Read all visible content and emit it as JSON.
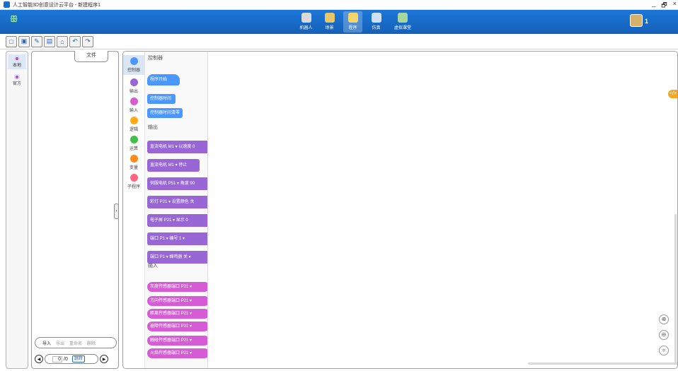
{
  "window": {
    "title": "人工智能3D创意设计云平台 - 新建程序1",
    "controls": [
      "_",
      "🗗",
      "×"
    ]
  },
  "topnav": {
    "logo": "ꕥ",
    "items": [
      {
        "label": "机器人",
        "icon": "robot-icon",
        "color": "#d9d9d9"
      },
      {
        "label": "场景",
        "icon": "scene-icon",
        "color": "#e8c76a"
      },
      {
        "label": "程序",
        "icon": "program-icon",
        "color": "#f5d66a",
        "active": true
      },
      {
        "label": "仿真",
        "icon": "simulation-icon",
        "color": "#cfe0f5"
      },
      {
        "label": "虚拟课堂",
        "icon": "virtual-classroom-icon",
        "color": "#a7d7a0"
      }
    ],
    "user_count": "1"
  },
  "toolbar": {
    "buttons": [
      "new-icon",
      "save-icon",
      "open-icon",
      "chart-icon",
      "home-icon",
      "undo-icon",
      "redo-icon"
    ]
  },
  "leftcol": {
    "items": [
      {
        "label": "本地",
        "active": true
      },
      {
        "label": "官方",
        "active": false
      }
    ]
  },
  "filepanel": {
    "tab": "文件",
    "actions": [
      "导入",
      "导出",
      "重命名",
      "删除"
    ],
    "pager": {
      "prev": "◀",
      "page_input": "0",
      "total": "/0",
      "go": "跳转",
      "next": "▶"
    }
  },
  "categories": [
    {
      "label": "控制器",
      "color": "#4c97ff",
      "active": true
    },
    {
      "label": "输出",
      "color": "#9966d6"
    },
    {
      "label": "输入",
      "color": "#d65cd6"
    },
    {
      "label": "逻辑",
      "color": "#ffab19"
    },
    {
      "label": "运算",
      "color": "#40bf4a"
    },
    {
      "label": "变量",
      "color": "#ff8c1a"
    },
    {
      "label": "子程序",
      "color": "#ff6680"
    }
  ],
  "palette": {
    "sections": [
      {
        "title": "控制器",
        "blocks": [
          "程序开始",
          "控制器时间",
          "控制器时间清零"
        ]
      },
      {
        "title": "输出",
        "blocks": [
          "直流电机 M1 ▾ 以速度 0",
          "直流电机 M1 ▾ 停止",
          "伺服电机 P51 ▾ 角度 90",
          "彩灯 P21 ▾ 设置颜色 关",
          "电子屏 P21 ▾ 显示 0",
          "端口 P1 ▾ 编号 1 ▾",
          "端口 P1 ▾ 蜂鸣器 关 ▾"
        ]
      },
      {
        "title": "输入",
        "blocks": [
          "灰度传感器端口 P21 ▾",
          "方向传感器端口 P21 ▾",
          "距离传感器端口 P21 ▾",
          "避障传感器端口 P21 ▾",
          "触碰传感器端口 P21 ▾",
          "火焰传感器端口 P21 ▾"
        ]
      }
    ]
  },
  "canvas": {
    "code_toggle": "</>",
    "zoom_in": "⊕",
    "zoom_out": "⊖",
    "zoom_reset": "="
  }
}
